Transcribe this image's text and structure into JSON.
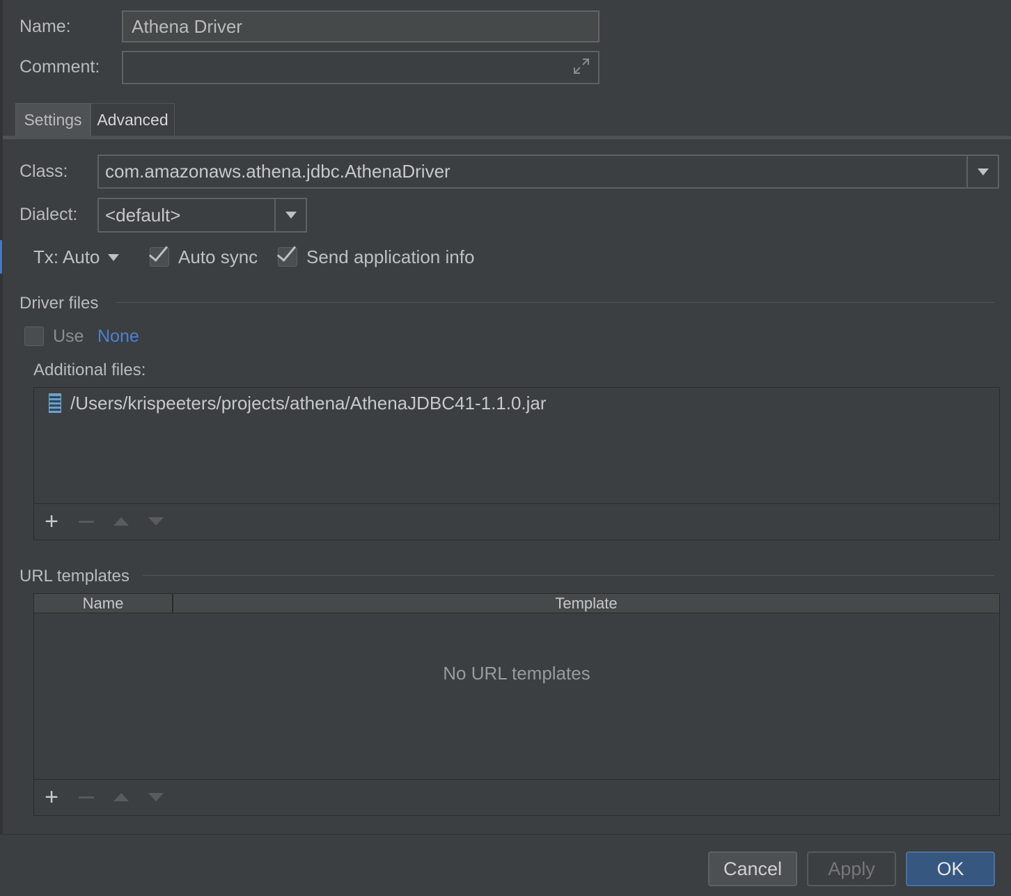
{
  "form": {
    "name_label": "Name:",
    "name_value": "Athena Driver",
    "comment_label": "Comment:",
    "comment_value": ""
  },
  "tabs": [
    {
      "label": "Settings",
      "selected": true
    },
    {
      "label": "Advanced",
      "selected": false
    }
  ],
  "settings": {
    "class_label": "Class:",
    "class_value": "com.amazonaws.athena.jdbc.AthenaDriver",
    "dialect_label": "Dialect:",
    "dialect_value": "<default>",
    "tx_label": "Tx: Auto",
    "auto_sync_label": "Auto sync",
    "auto_sync_checked": true,
    "send_info_label": "Send application info",
    "send_info_checked": true
  },
  "driver_files": {
    "section_title": "Driver files",
    "use_label": "Use",
    "use_checked": false,
    "use_value": "None",
    "additional_label": "Additional files:",
    "files": [
      "/Users/krispeeters/projects/athena/AthenaJDBC41-1.1.0.jar"
    ]
  },
  "url_templates": {
    "section_title": "URL templates",
    "columns": [
      "Name",
      "Template"
    ],
    "empty_text": "No URL templates"
  },
  "buttons": {
    "cancel": "Cancel",
    "apply": "Apply",
    "ok": "OK"
  },
  "colors": {
    "background": "#3c3f41",
    "link": "#4f7fcf",
    "ok_button": "#365880"
  }
}
